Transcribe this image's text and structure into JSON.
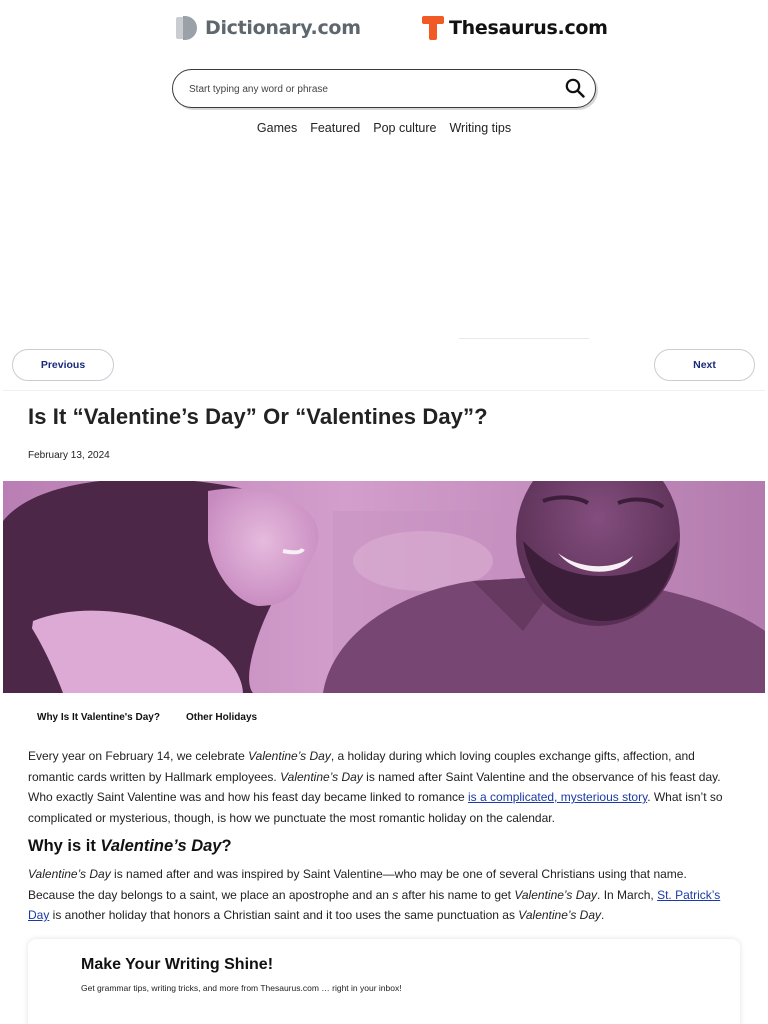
{
  "header": {
    "dictionary_logo": "Dictionary.com",
    "thesaurus_logo": "Thesaurus.com",
    "search_placeholder": "Start typing any word or phrase",
    "nav": [
      "Games",
      "Featured",
      "Pop culture",
      "Writing tips"
    ]
  },
  "pager": {
    "previous": "Previous",
    "next": "Next"
  },
  "article": {
    "title": "Is It “Valentine’s Day” Or “Valentines Day”?",
    "date": "February 13, 2024",
    "toc": [
      "Why Is It Valentine's Day?",
      "Other Holidays"
    ],
    "p1": {
      "t1": "Every year on February 14, we celebrate ",
      "i1": "Valentine’s Day",
      "t2": ", a holiday during which loving couples exchange gifts, affection, and romantic cards written by Hallmark employees. ",
      "i2": "Valentine’s Day",
      "t3": " is named after Saint Valentine and the observance of his feast day. Who exactly Saint Valentine was and how his feast day became linked to romance ",
      "link": "is a complicated, mysterious story",
      "t4": ". What isn’t so complicated or mysterious, though, is how we punctuate the most romantic holiday on the calendar."
    },
    "h2": {
      "lead": "Why is it ",
      "italic": "Valentine’s Day",
      "end": "?"
    },
    "p2": {
      "i1": "Valentine’s Day",
      "t1": " is named after and was inspired by Saint Valentine—who may be one of several Christians using that name. Because the day belongs to a saint, we place an apostrophe and an ",
      "i2": "s",
      "t2": " after his name to get ",
      "i3": "Valentine’s Day",
      "t3": ". In March, ",
      "link": "St. Patrick’s Day",
      "t4": " is another holiday that honors a Christian saint and it too uses the same punctuation as ",
      "i4": "Valentine’s Day",
      "t5": "."
    }
  },
  "newsletter": {
    "title": "Make Your Writing Shine!",
    "subtitle": "Get grammar tips, writing tricks, and more from Thesaurus.com … right in your inbox!"
  },
  "colors": {
    "link": "#1a3aa6",
    "pager_text": "#1a2a7c",
    "thesaurus_brand": "#f15a24",
    "hero_tint": "#c98fc4"
  },
  "icons": [
    "dictionary-logo-icon",
    "thesaurus-logo-icon",
    "search-icon"
  ]
}
